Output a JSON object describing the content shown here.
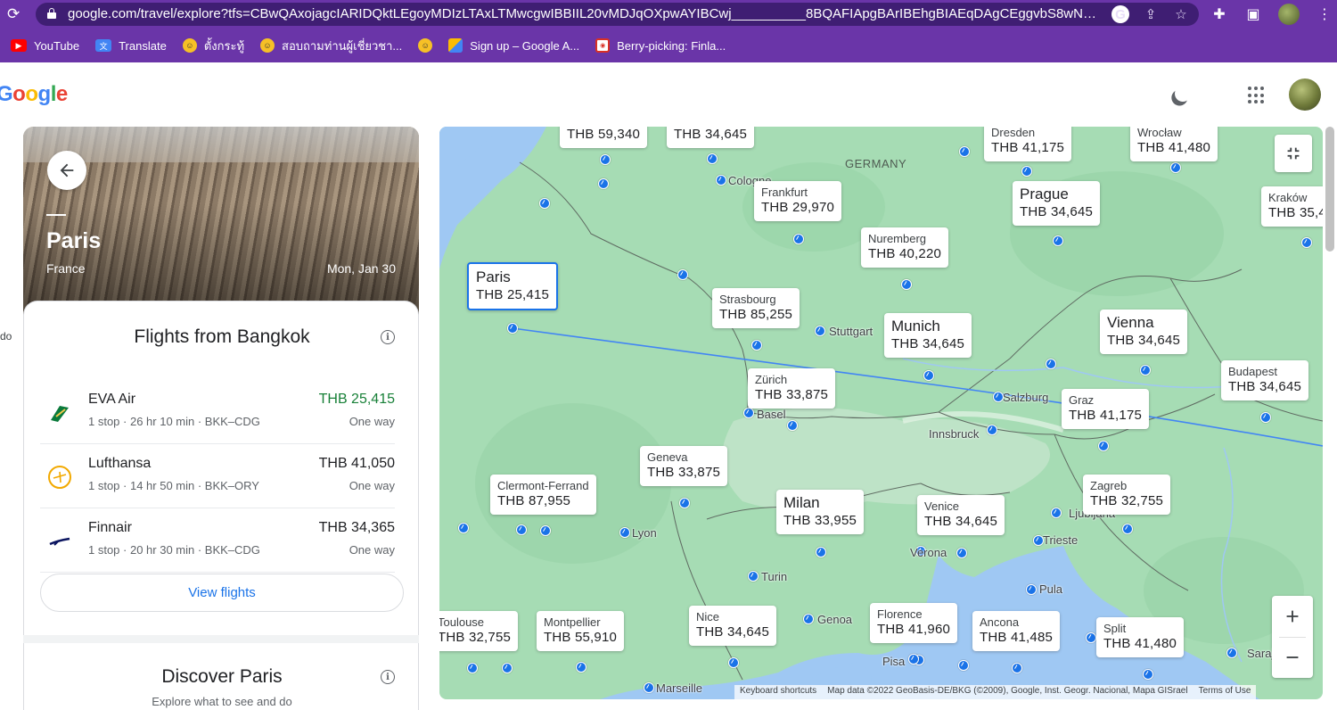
{
  "browser": {
    "url": "google.com/travel/explore?tfs=CBwQAxojagcIARIDQktLEgoyMDIzLTAxLTMwcgwIBBIIL20vMDJqOXpwAYIBCwj__________8BQAFIApgBArIBEhgBIAEqDAgCEggvbS8wNXF...",
    "bookmarks": [
      {
        "label": "YouTube",
        "icon": "youtube-icon"
      },
      {
        "label": "Translate",
        "icon": "translate-icon"
      },
      {
        "label": "ตั้งกระทู้",
        "icon": "pantip-icon"
      },
      {
        "label": "สอบถามท่านผู้เชี่ยวชา...",
        "icon": "pantip-icon"
      },
      {
        "label": "",
        "icon": "pantip-icon"
      },
      {
        "label": "Sign up – Google A...",
        "icon": "google-ads-icon"
      },
      {
        "label": "Berry-picking: Finla...",
        "icon": "news-icon"
      }
    ]
  },
  "header": {
    "logo": {
      "g1": "G",
      "o1": "o",
      "o2": "o",
      "g2": "g",
      "l": "l",
      "e": "e"
    }
  },
  "left_stub": "do",
  "destination": {
    "city": "Paris",
    "country": "France",
    "date": "Mon, Jan 30"
  },
  "flights_card": {
    "title": "Flights from Bangkok",
    "info_glyph": "i",
    "flights": [
      {
        "airline": "EVA Air",
        "meta": "1 stop · 26 hr 10 min · BKK–CDG",
        "price": "THB 25,415",
        "trip": "One way",
        "best": true
      },
      {
        "airline": "Lufthansa",
        "meta": "1 stop · 14 hr 50 min · BKK–ORY",
        "price": "THB 41,050",
        "trip": "One way",
        "best": false
      },
      {
        "airline": "Finnair",
        "meta": "1 stop · 20 hr 30 min · BKK–CDG",
        "price": "THB 34,365",
        "trip": "One way",
        "best": false
      }
    ],
    "view_button": "View flights"
  },
  "discover": {
    "title": "Discover Paris",
    "subtitle": "Explore what to see and do"
  },
  "map": {
    "country_label": "GERMANY",
    "bubbles": [
      {
        "name": "",
        "price": "THB 59,340"
      },
      {
        "name": "",
        "price": "THB 34,645"
      },
      {
        "name": "Dresden",
        "price": "THB 41,175"
      },
      {
        "name": "Wrocław",
        "price": "THB 41,480"
      },
      {
        "name": "Frankfurt",
        "price": "THB 29,970"
      },
      {
        "name": "Prague",
        "price": "THB 34,645"
      },
      {
        "name": "Kraków",
        "price": "THB 35,4"
      },
      {
        "name": "Nuremberg",
        "price": "THB 40,220"
      },
      {
        "name": "Paris",
        "price": "THB 25,415"
      },
      {
        "name": "Strasbourg",
        "price": "THB 85,255"
      },
      {
        "name": "Munich",
        "price": "THB 34,645"
      },
      {
        "name": "Vienna",
        "price": "THB 34,645"
      },
      {
        "name": "Budapest",
        "price": "THB 34,645"
      },
      {
        "name": "Zürich",
        "price": "THB 33,875"
      },
      {
        "name": "Graz",
        "price": "THB 41,175"
      },
      {
        "name": "Geneva",
        "price": "THB 33,875"
      },
      {
        "name": "Clermont-Ferrand",
        "price": "THB 87,955"
      },
      {
        "name": "Milan",
        "price": "THB 33,955"
      },
      {
        "name": "Venice",
        "price": "THB 34,645"
      },
      {
        "name": "Zagreb",
        "price": "THB 32,755"
      },
      {
        "name": "Toulouse",
        "price": "THB 32,755"
      },
      {
        "name": "Montpellier",
        "price": "THB 55,910"
      },
      {
        "name": "Nice",
        "price": "THB 34,645"
      },
      {
        "name": "Florence",
        "price": "THB 41,960"
      },
      {
        "name": "Ancona",
        "price": "THB 41,485"
      },
      {
        "name": "Split",
        "price": "THB 41,480"
      }
    ],
    "city_labels": [
      "Cologne",
      "Stuttgart",
      "Salzburg",
      "Innsbruck",
      "Basel",
      "Lyon",
      "Ljubljana",
      "Trieste",
      "Verona",
      "Turin",
      "Pula",
      "Genoa",
      "Pisa",
      "Marseille",
      "Sarajevo",
      "Ancona"
    ],
    "attribution": {
      "shortcuts": "Keyboard shortcuts",
      "data": "Map data ©2022 GeoBasis-DE/BKG (©2009), Google, Inst. Geogr. Nacional, Mapa GISrael",
      "terms": "Terms of Use"
    },
    "route_color": "#4285f4",
    "marker_color": "#1a73e8",
    "land_color": "#a6dcb4",
    "water_color": "#9fc8f3"
  }
}
